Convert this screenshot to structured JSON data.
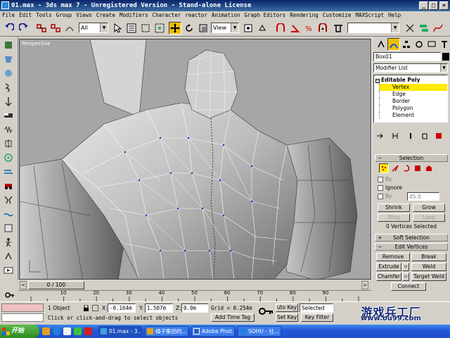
{
  "window": {
    "title": "01.max - 3ds max 7 - Unregistered Version - Stand-alone License",
    "min_label": "_",
    "max_label": "□",
    "close_label": "×"
  },
  "menubar": [
    "File",
    "Edit",
    "Tools",
    "Group",
    "Views",
    "Create",
    "Modifiers",
    "Character",
    "reactor",
    "Animation",
    "Graph Editors",
    "Rendering",
    "Customize",
    "MAXScript",
    "Help"
  ],
  "toolbar": {
    "selection_filter": "All",
    "reference_coord": "View"
  },
  "viewport": {
    "label": "Perspective"
  },
  "command_panel": {
    "object_name": "Box01",
    "modifier_list": "Modifier List",
    "stack": {
      "root": "Editable Poly",
      "items": [
        "Vertex",
        "Edge",
        "Border",
        "Polygon",
        "Element"
      ],
      "selected_index": 0
    },
    "selection": {
      "header": "Selection",
      "by_vertex": "By",
      "ignore_backfacing": "Ignore",
      "by_angle": "By",
      "angle_value": "45.0",
      "shrink": "Shrink",
      "grow": "Grow",
      "ring": "Ring",
      "loop": "Loop",
      "status": "0 Vertices Selected"
    },
    "soft_selection": {
      "header": "Soft Selection"
    },
    "edit_vertices": {
      "header": "Edit Vertices",
      "remove": "Remove",
      "break": "Break",
      "extrude": "Extrude",
      "weld": "Weld",
      "chamfer": "Chamfer",
      "target_weld": "Target Weld",
      "connect": "Connect"
    }
  },
  "timeline": {
    "frame_readout": "0 / 100",
    "ticks": [
      "10",
      "20",
      "30",
      "40",
      "50",
      "60",
      "70",
      "80",
      "90"
    ]
  },
  "status": {
    "selected": "1 Object",
    "x_label": "X:",
    "x_value": "-0.164m",
    "y_label": "Y:",
    "y_value": "1.507m",
    "z_label": "Z:",
    "z_value": "0.0m",
    "grid": "Grid = 0.254m",
    "add_time_tag": "Add Time Tag",
    "auto_key": "uto Key",
    "set_key": "Set Key",
    "key_mode": "Selected",
    "key_filters": "Key Filter",
    "prompt": "Click or click-and-drag to select objects"
  },
  "watermark": {
    "text_cn": "游戏兵工厂",
    "url": "www.ou99.com"
  },
  "taskbar": {
    "start": "开始",
    "tasks": [
      "01.max - 3...",
      "橘子集团的...",
      "Adobe Phot...",
      "SOHU - 社..."
    ]
  },
  "colors": {
    "active_item": "#ffea00",
    "title_bar": "#0a246a",
    "viewport_bg": "#a6a6a6"
  }
}
